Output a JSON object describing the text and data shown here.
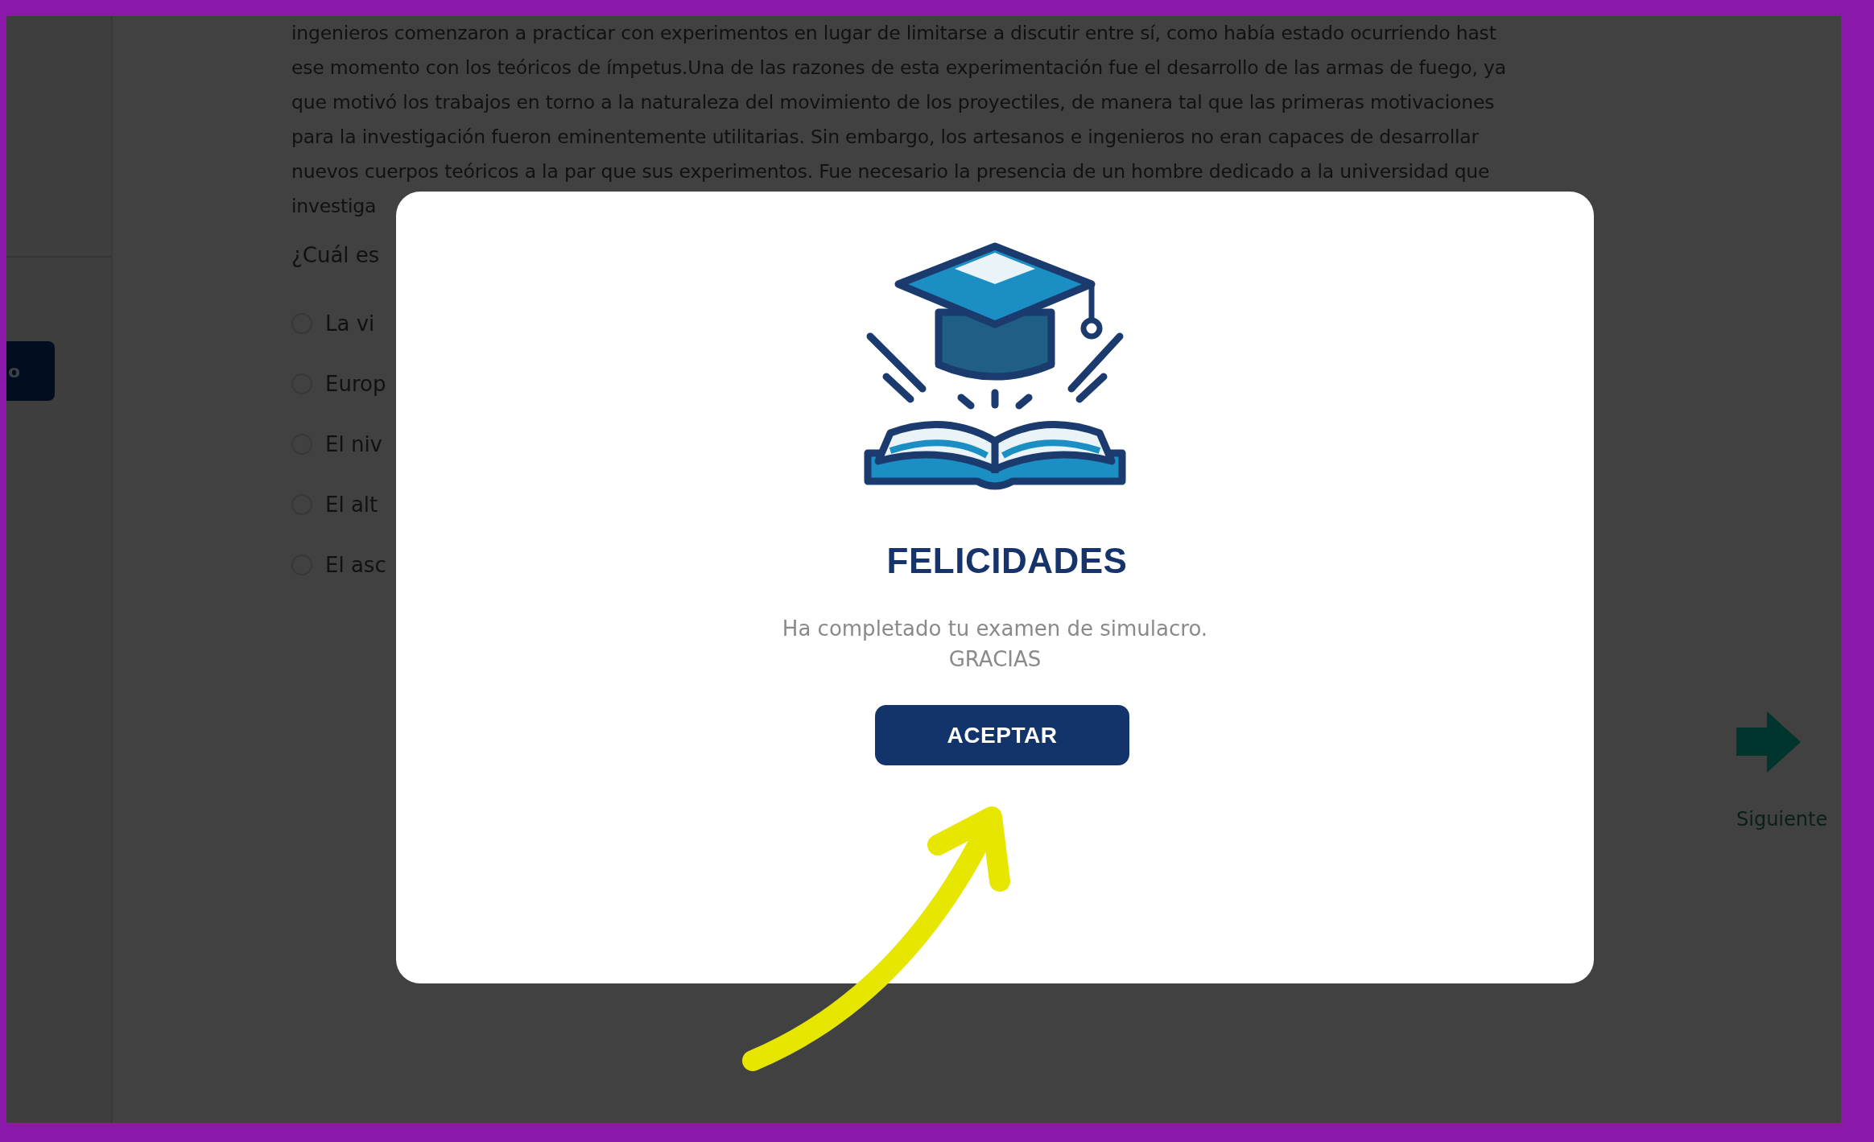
{
  "sidebar": {
    "button_label": "o"
  },
  "content": {
    "paragraph_lines": [
      "ingenieros comenzaron a practicar con experimentos en lugar de limitarse a discutir entre sí, como había estado ocurriendo hast",
      "ese momento con los teóricos de ímpetus.Una de las razones de esta experimentación fue el desarrollo de las armas de fuego, ya",
      "que motivó los trabajos en torno a la naturaleza del movimiento de los proyectiles, de manera tal que las primeras motivaciones",
      "para la investigación fueron eminentemente utilitarias. Sin embargo, los artesanos e ingenieros no eran capaces de desarrollar",
      "nuevos cuerpos teóricos a la par que sus experimentos. Fue necesario la presencia de un hombre dedicado a la universidad que",
      "investiga"
    ],
    "question": "¿Cuál es",
    "options": [
      {
        "label": "La vi",
        "selected": false
      },
      {
        "label": "Europ",
        "selected": false
      },
      {
        "label": "El niv",
        "selected": false
      },
      {
        "label": "El alt",
        "selected": false
      },
      {
        "label": "El asc",
        "selected": false
      }
    ],
    "next_label": "Siguiente"
  },
  "modal": {
    "title": "FELICIDADES",
    "message_lines": [
      "Ha completado tu examen de simulacro.",
      "GRACIAS"
    ],
    "button": "ACEPTAR"
  }
}
